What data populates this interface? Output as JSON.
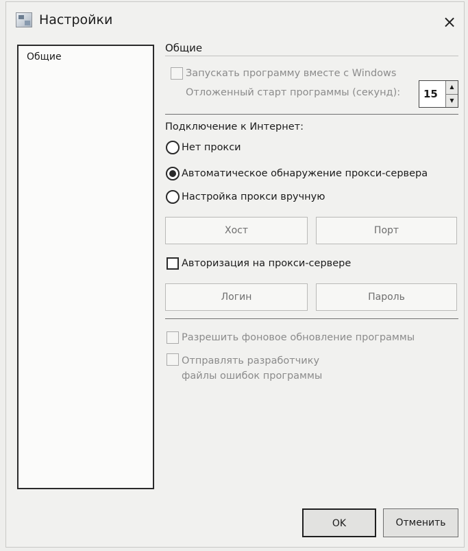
{
  "window": {
    "title": "Настройки",
    "close_icon": "×"
  },
  "sidebar": {
    "items": [
      {
        "label": "Общие"
      }
    ]
  },
  "general": {
    "title": "Общие",
    "autostart_label": "Запускать программу вместе с Windows",
    "autostart_checked": false,
    "delay_label": "Отложенный старт программы (секунд):",
    "delay_value": "15"
  },
  "connection": {
    "title": "Подключение к Интернет:",
    "options": [
      {
        "label": "Нет прокси",
        "checked": false
      },
      {
        "label": "Автоматическое обнаружение прокси-сервера",
        "checked": true
      },
      {
        "label": "Настройка прокси вручную",
        "checked": false
      }
    ],
    "host_placeholder": "Хост",
    "port_placeholder": "Порт",
    "auth_label": "Авторизация на прокси-сервере",
    "auth_checked": false,
    "login_placeholder": "Логин",
    "password_placeholder": "Пароль"
  },
  "extra": {
    "background_update_label": "Разрешить фоновое обновление программы",
    "send_errors_label": "Отправлять разработчику файлы ошибок программы"
  },
  "buttons": {
    "ok": "OK",
    "cancel": "Отменить"
  }
}
